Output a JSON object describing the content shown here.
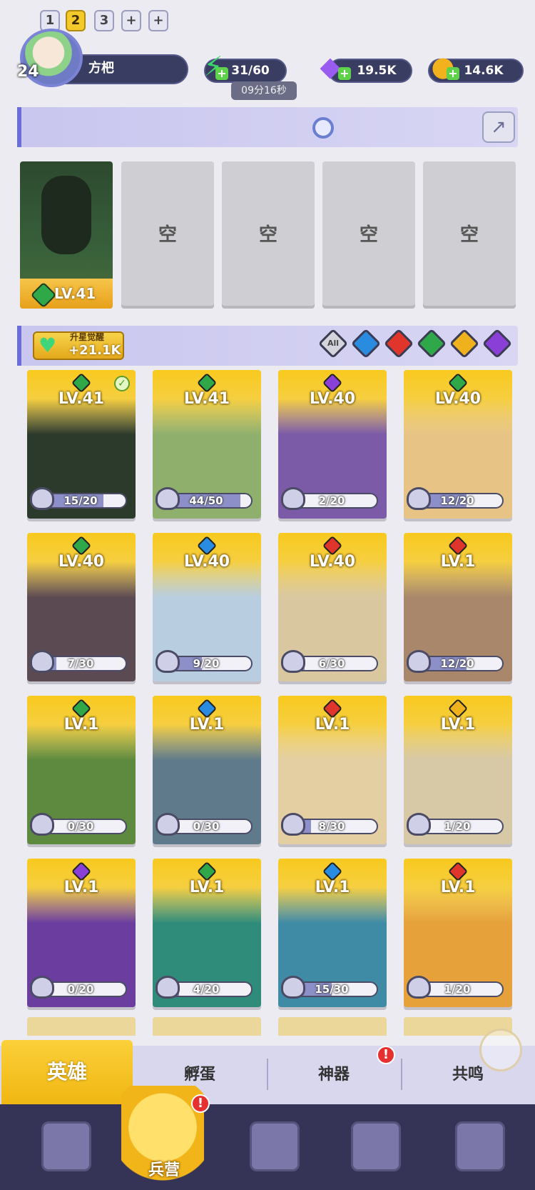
{
  "player": {
    "level": "24",
    "name": "方杷"
  },
  "resources": {
    "energy": "31/60",
    "energy_timer": "09分16秒",
    "gems": "19.5K",
    "gold": "14.6K"
  },
  "team_tabs": [
    "1",
    "2",
    "3",
    "+",
    "+"
  ],
  "team_active_index": 1,
  "squad": {
    "hero_level": "LV.41",
    "empty_label": "空"
  },
  "awake": {
    "label": "升星觉醒",
    "value": "+21.1K"
  },
  "filters": [
    "All",
    "water",
    "fire",
    "nature",
    "light",
    "dark"
  ],
  "colors": {
    "nature": "#2fa84a",
    "water": "#2a8ce0",
    "fire": "#e0352a",
    "light": "#f0b21c",
    "dark": "#8a3fd6",
    "gold": "#f6c62a"
  },
  "heroes": [
    {
      "level": "LV.41",
      "element": "nature",
      "shards": "15/20",
      "progress": 0.75,
      "selected": true,
      "art": "#2c3a2c"
    },
    {
      "level": "LV.41",
      "element": "nature",
      "shards": "44/50",
      "progress": 0.88,
      "selected": false,
      "art": "#8fb06c"
    },
    {
      "level": "LV.40",
      "element": "dark",
      "shards": "2/20",
      "progress": 0.1,
      "selected": false,
      "art": "#7b5aa8"
    },
    {
      "level": "LV.40",
      "element": "nature",
      "shards": "12/20",
      "progress": 0.6,
      "selected": false,
      "art": "#e7c486"
    },
    {
      "level": "LV.40",
      "element": "nature",
      "shards": "7/30",
      "progress": 0.23,
      "selected": false,
      "art": "#5c4a52"
    },
    {
      "level": "LV.40",
      "element": "water",
      "shards": "9/20",
      "progress": 0.45,
      "selected": false,
      "art": "#b8cde0"
    },
    {
      "level": "LV.40",
      "element": "fire",
      "shards": "6/30",
      "progress": 0.2,
      "selected": false,
      "art": "#d9c7a0"
    },
    {
      "level": "LV.1",
      "element": "fire",
      "shards": "12/20",
      "progress": 0.6,
      "selected": false,
      "art": "#a8876a"
    },
    {
      "level": "LV.1",
      "element": "nature",
      "shards": "0/30",
      "progress": 0.0,
      "selected": false,
      "art": "#5d8a3e"
    },
    {
      "level": "LV.1",
      "element": "water",
      "shards": "0/30",
      "progress": 0.0,
      "selected": false,
      "art": "#5f7a8a"
    },
    {
      "level": "LV.1",
      "element": "fire",
      "shards": "8/30",
      "progress": 0.27,
      "selected": false,
      "art": "#e3cfa2"
    },
    {
      "level": "LV.1",
      "element": "light",
      "shards": "1/20",
      "progress": 0.05,
      "selected": false,
      "art": "#d7c9a6"
    },
    {
      "level": "LV.1",
      "element": "dark",
      "shards": "0/20",
      "progress": 0.0,
      "selected": false,
      "art": "#6a3d9e"
    },
    {
      "level": "LV.1",
      "element": "nature",
      "shards": "4/20",
      "progress": 0.2,
      "selected": false,
      "art": "#2f8c7a"
    },
    {
      "level": "LV.1",
      "element": "water",
      "shards": "15/30",
      "progress": 0.5,
      "selected": false,
      "art": "#3f8ba6"
    },
    {
      "level": "LV.1",
      "element": "fire",
      "shards": "1/20",
      "progress": 0.05,
      "selected": false,
      "art": "#e6a13a"
    }
  ],
  "subtabs": [
    "英雄",
    "孵蛋",
    "神器",
    "共鸣"
  ],
  "subtab_badge": "!",
  "nav": {
    "center_label": "兵营",
    "badge": "!"
  }
}
